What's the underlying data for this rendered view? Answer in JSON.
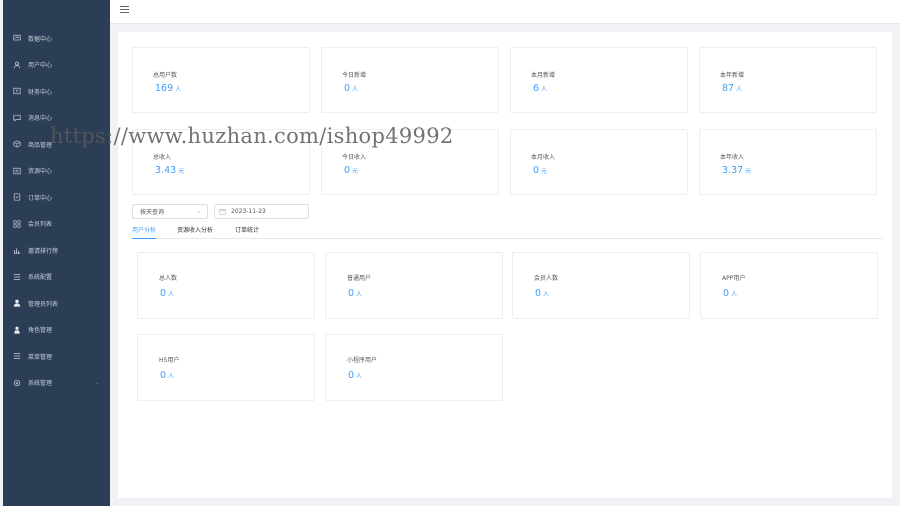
{
  "sidebar": {
    "items": [
      {
        "label": "数据中心",
        "icon": "monitor-icon"
      },
      {
        "label": "用户中心",
        "icon": "user-icon"
      },
      {
        "label": "财务中心",
        "icon": "finance-icon"
      },
      {
        "label": "消息中心",
        "icon": "message-icon"
      },
      {
        "label": "商品管理",
        "icon": "box-icon"
      },
      {
        "label": "资源中心",
        "icon": "resource-icon"
      },
      {
        "label": "订单中心",
        "icon": "order-icon"
      },
      {
        "label": "会员列表",
        "icon": "grid-icon"
      },
      {
        "label": "邀请排行榜",
        "icon": "bar-chart-icon"
      },
      {
        "label": "系统配置",
        "icon": "list-icon"
      },
      {
        "label": "管理员列表",
        "icon": "admin-user-icon"
      },
      {
        "label": "角色管理",
        "icon": "role-user-icon"
      },
      {
        "label": "菜单管理",
        "icon": "menu-list-icon"
      },
      {
        "label": "系统管理",
        "icon": "gear-icon"
      }
    ]
  },
  "stats_users": [
    {
      "label": "总用户数",
      "value": "169",
      "unit": "人"
    },
    {
      "label": "今日新增",
      "value": "0",
      "unit": "人"
    },
    {
      "label": "本月新增",
      "value": "6",
      "unit": "人"
    },
    {
      "label": "本年新增",
      "value": "87",
      "unit": "人"
    }
  ],
  "stats_income": [
    {
      "label": "总收入",
      "value": "3.43",
      "unit": "元"
    },
    {
      "label": "今日收入",
      "value": "0",
      "unit": "元"
    },
    {
      "label": "本月收入",
      "value": "0",
      "unit": "元"
    },
    {
      "label": "本年收入",
      "value": "3.37",
      "unit": "元"
    }
  ],
  "filters": {
    "mode_select": "按天查询",
    "date": "2023-11-23"
  },
  "tabs": [
    {
      "label": "用户分析"
    },
    {
      "label": "资源收入分析"
    },
    {
      "label": "订单统计"
    }
  ],
  "user_analysis": [
    {
      "label": "总人数",
      "value": "0",
      "unit": "人"
    },
    {
      "label": "普通用户",
      "value": "0",
      "unit": "人"
    },
    {
      "label": "会员人数",
      "value": "0",
      "unit": "人"
    },
    {
      "label": "APP用户",
      "value": "0",
      "unit": "人"
    },
    {
      "label": "H5用户",
      "value": "0",
      "unit": "人"
    },
    {
      "label": "小程序用户",
      "value": "0",
      "unit": "人"
    }
  ],
  "watermark": "https://www.huzhan.com/ishop49992",
  "colors": {
    "sidebar_bg": "#2c3e55",
    "accent": "#409eff",
    "page_bg": "#f0f2f5"
  }
}
